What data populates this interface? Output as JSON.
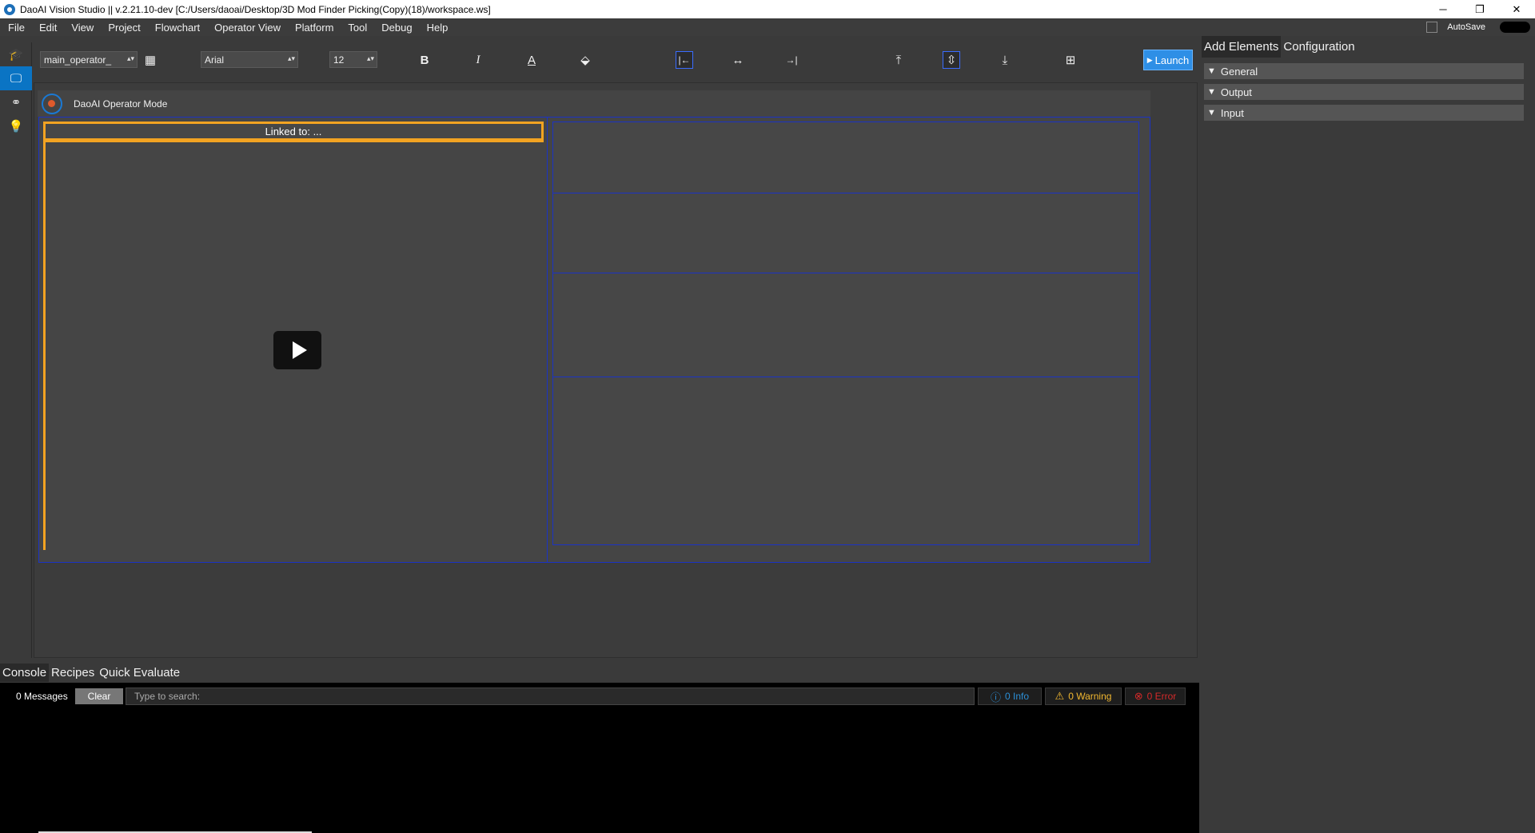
{
  "window": {
    "title": "DaoAI Vision Studio || v.2.21.10-dev  [C:/Users/daoai/Desktop/3D Mod Finder Picking(Copy)(18)/workspace.ws]",
    "controls": [
      "─",
      "❐",
      "✕"
    ]
  },
  "menu": [
    "File",
    "Edit",
    "View",
    "Project",
    "Flowchart",
    "Operator View",
    "Platform",
    "Tool",
    "Debug",
    "Help"
  ],
  "autosave": {
    "label": "AutoSave",
    "enabled": true
  },
  "leftbar": [
    "graduation-cap-icon",
    "monitor-icon",
    "flowchart-icon",
    "lightbulb-icon"
  ],
  "toolbar": {
    "view_select": "main_operator_",
    "font_select": "Arial",
    "font_size": "12",
    "launch_label": "Launch",
    "icons": {
      "bold": "B",
      "italic": "I",
      "font_color": "A",
      "fill": "⬙",
      "align_left": "|←",
      "align_center": "↔",
      "align_right": "→|",
      "align_top": "⤒",
      "align_middle": "⇳",
      "align_bottom": "⤓",
      "grid": "⊞"
    }
  },
  "operator": {
    "header_title": "DaoAI Operator Mode",
    "linked_label": "Linked to: ..."
  },
  "right_panel": {
    "tabs": [
      "Add Elements",
      "Configuration"
    ],
    "sections": [
      "General",
      "Output",
      "Input"
    ]
  },
  "bottom": {
    "tabs": [
      "Console",
      "Recipes",
      "Quick Evaluate"
    ],
    "message_count": "0 Messages",
    "clear_label": "Clear",
    "search_placeholder": "Type to search:",
    "info": "0 Info",
    "warning": "0 Warning",
    "error": "0 Error"
  },
  "colors": {
    "accent_blue": "#0a74c4",
    "frame_blue": "#1b33c4",
    "selection_orange": "#f2a322",
    "launch_blue": "#2e8fe6"
  }
}
